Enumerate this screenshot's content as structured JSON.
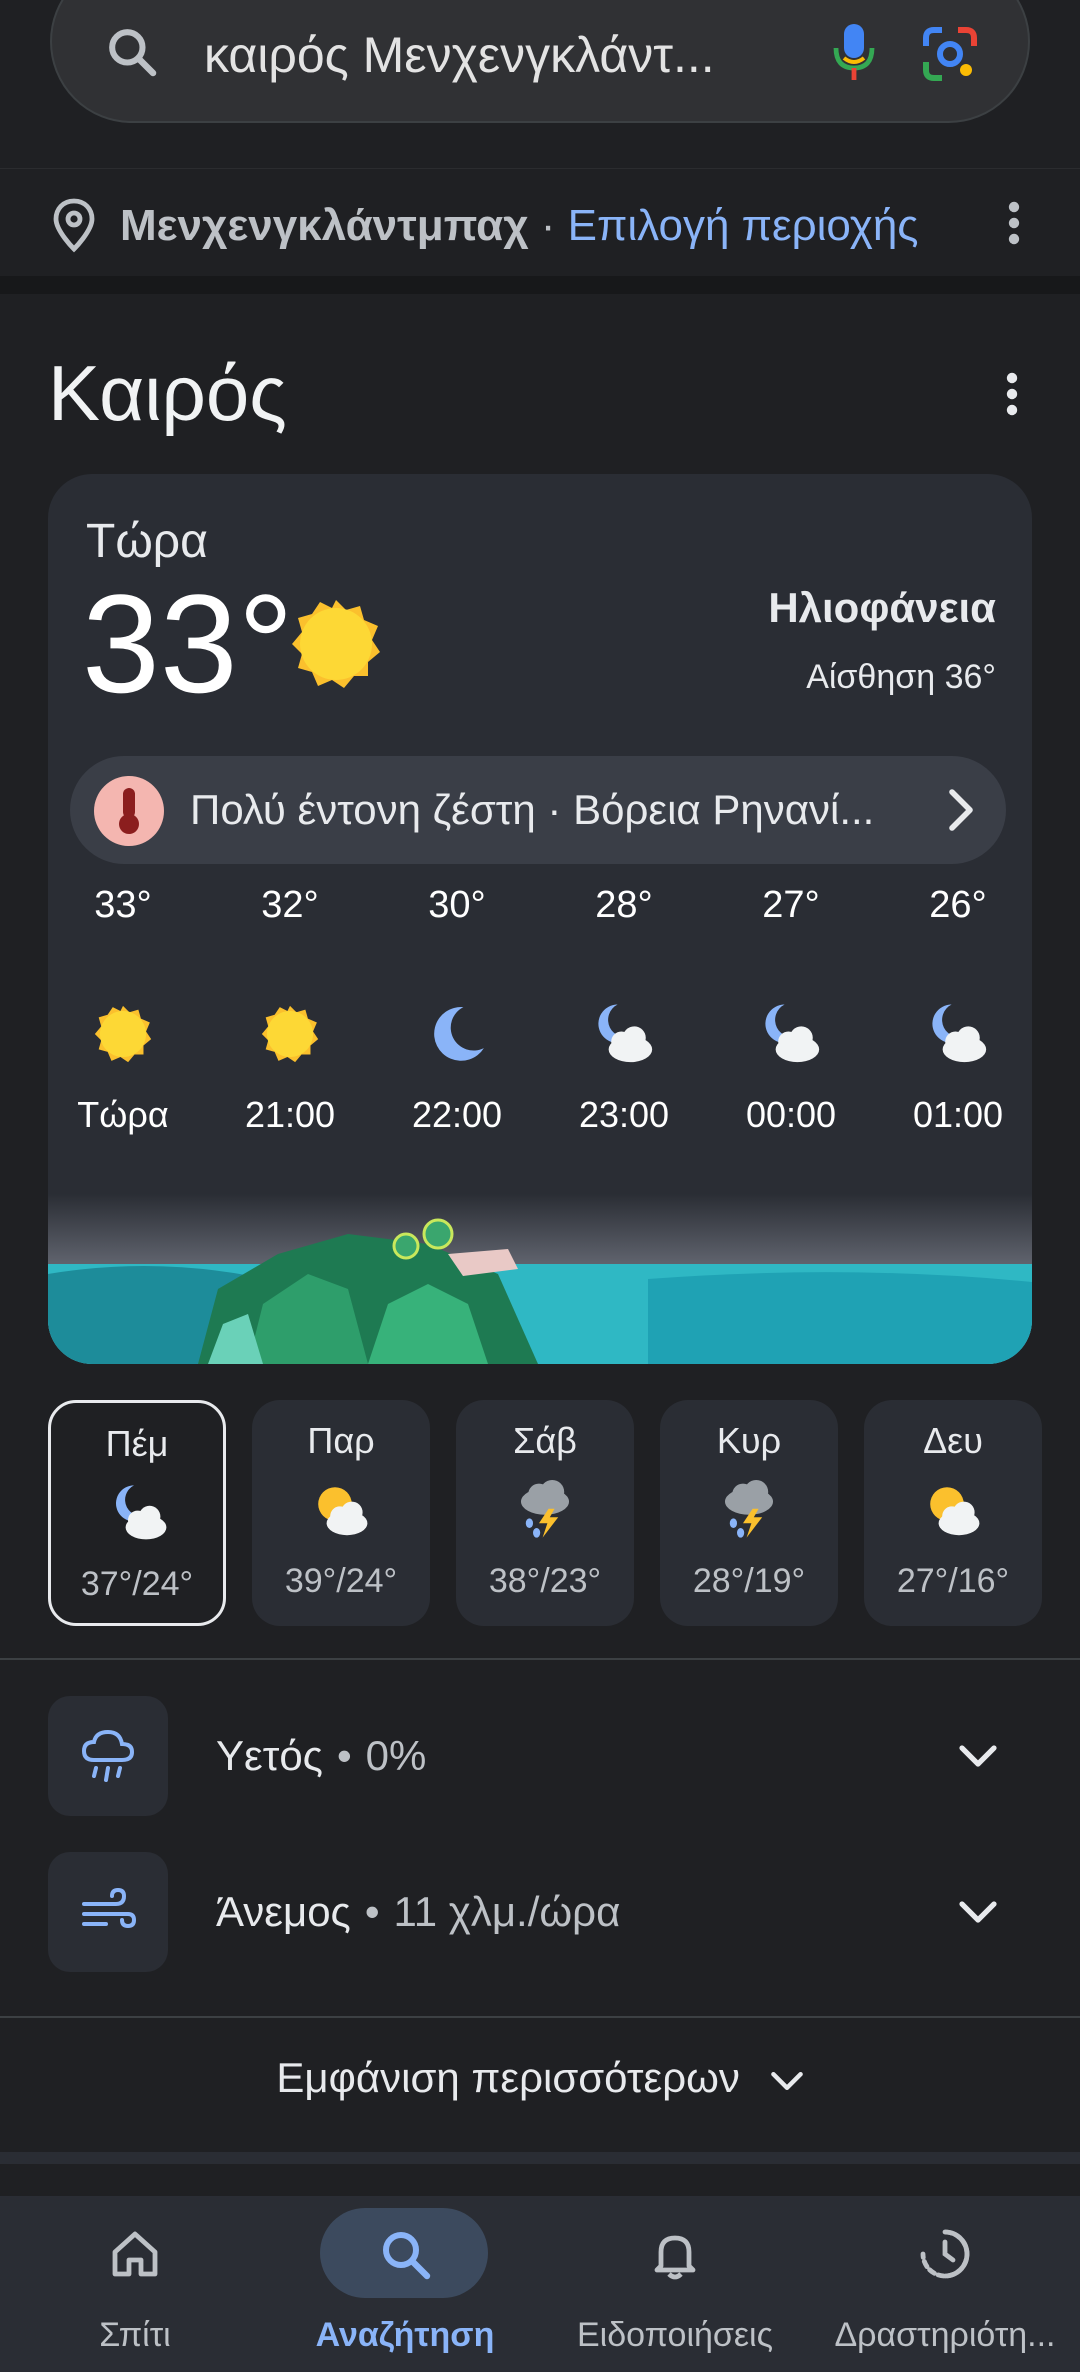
{
  "search": {
    "query": "καιρός Μενχενγκλάντ..."
  },
  "location": {
    "name": "Μενχενγκλάντμπαχ",
    "separator": "·",
    "choose_label": "Επιλογή περιοχής"
  },
  "weather": {
    "title": "Καιρός",
    "now_label": "Τώρα",
    "current_temp": "33°",
    "condition": "Ηλιοφάνεια",
    "feels_like": "Αίσθηση 36°",
    "alert": {
      "title": "Πολύ έντονη ζέστη",
      "separator": "·",
      "region": "Βόρεια Ρηνανί..."
    },
    "hourly": [
      {
        "temp": "33°",
        "time": "Τώρα",
        "icon": "sun-icon"
      },
      {
        "temp": "32°",
        "time": "21:00",
        "icon": "sun-icon"
      },
      {
        "temp": "30°",
        "time": "22:00",
        "icon": "moon-icon"
      },
      {
        "temp": "28°",
        "time": "23:00",
        "icon": "moon-cloud-icon"
      },
      {
        "temp": "27°",
        "time": "00:00",
        "icon": "moon-cloud-icon"
      },
      {
        "temp": "26°",
        "time": "01:00",
        "icon": "moon-cloud-icon"
      }
    ],
    "daily": [
      {
        "day": "Πέμ",
        "range": "37°/24°",
        "icon": "moon-cloud-icon",
        "selected": true
      },
      {
        "day": "Παρ",
        "range": "39°/24°",
        "icon": "sun-cloud-icon"
      },
      {
        "day": "Σάβ",
        "range": "38°/23°",
        "icon": "thunderstorm-icon"
      },
      {
        "day": "Κυρ",
        "range": "28°/19°",
        "icon": "thunderstorm-icon"
      },
      {
        "day": "Δευ",
        "range": "27°/16°",
        "icon": "sun-cloud-icon"
      }
    ],
    "precipitation": {
      "label": "Υετός",
      "separator": "•",
      "value": "0%"
    },
    "wind": {
      "label": "Άνεμος",
      "separator": "•",
      "value": "11 χλμ./ώρα"
    },
    "show_more": "Εμφάνιση περισσότερων"
  },
  "nav": {
    "home": "Σπίτι",
    "search": "Αναζήτηση",
    "notifications": "Ειδοποιήσεις",
    "activity": "Δραστηριότη..."
  },
  "colors": {
    "background": "#1f2023",
    "card": "#2a2d34",
    "accent": "#8ab4f8",
    "sun": "#fbc02d",
    "moon": "#8ab4f8"
  }
}
